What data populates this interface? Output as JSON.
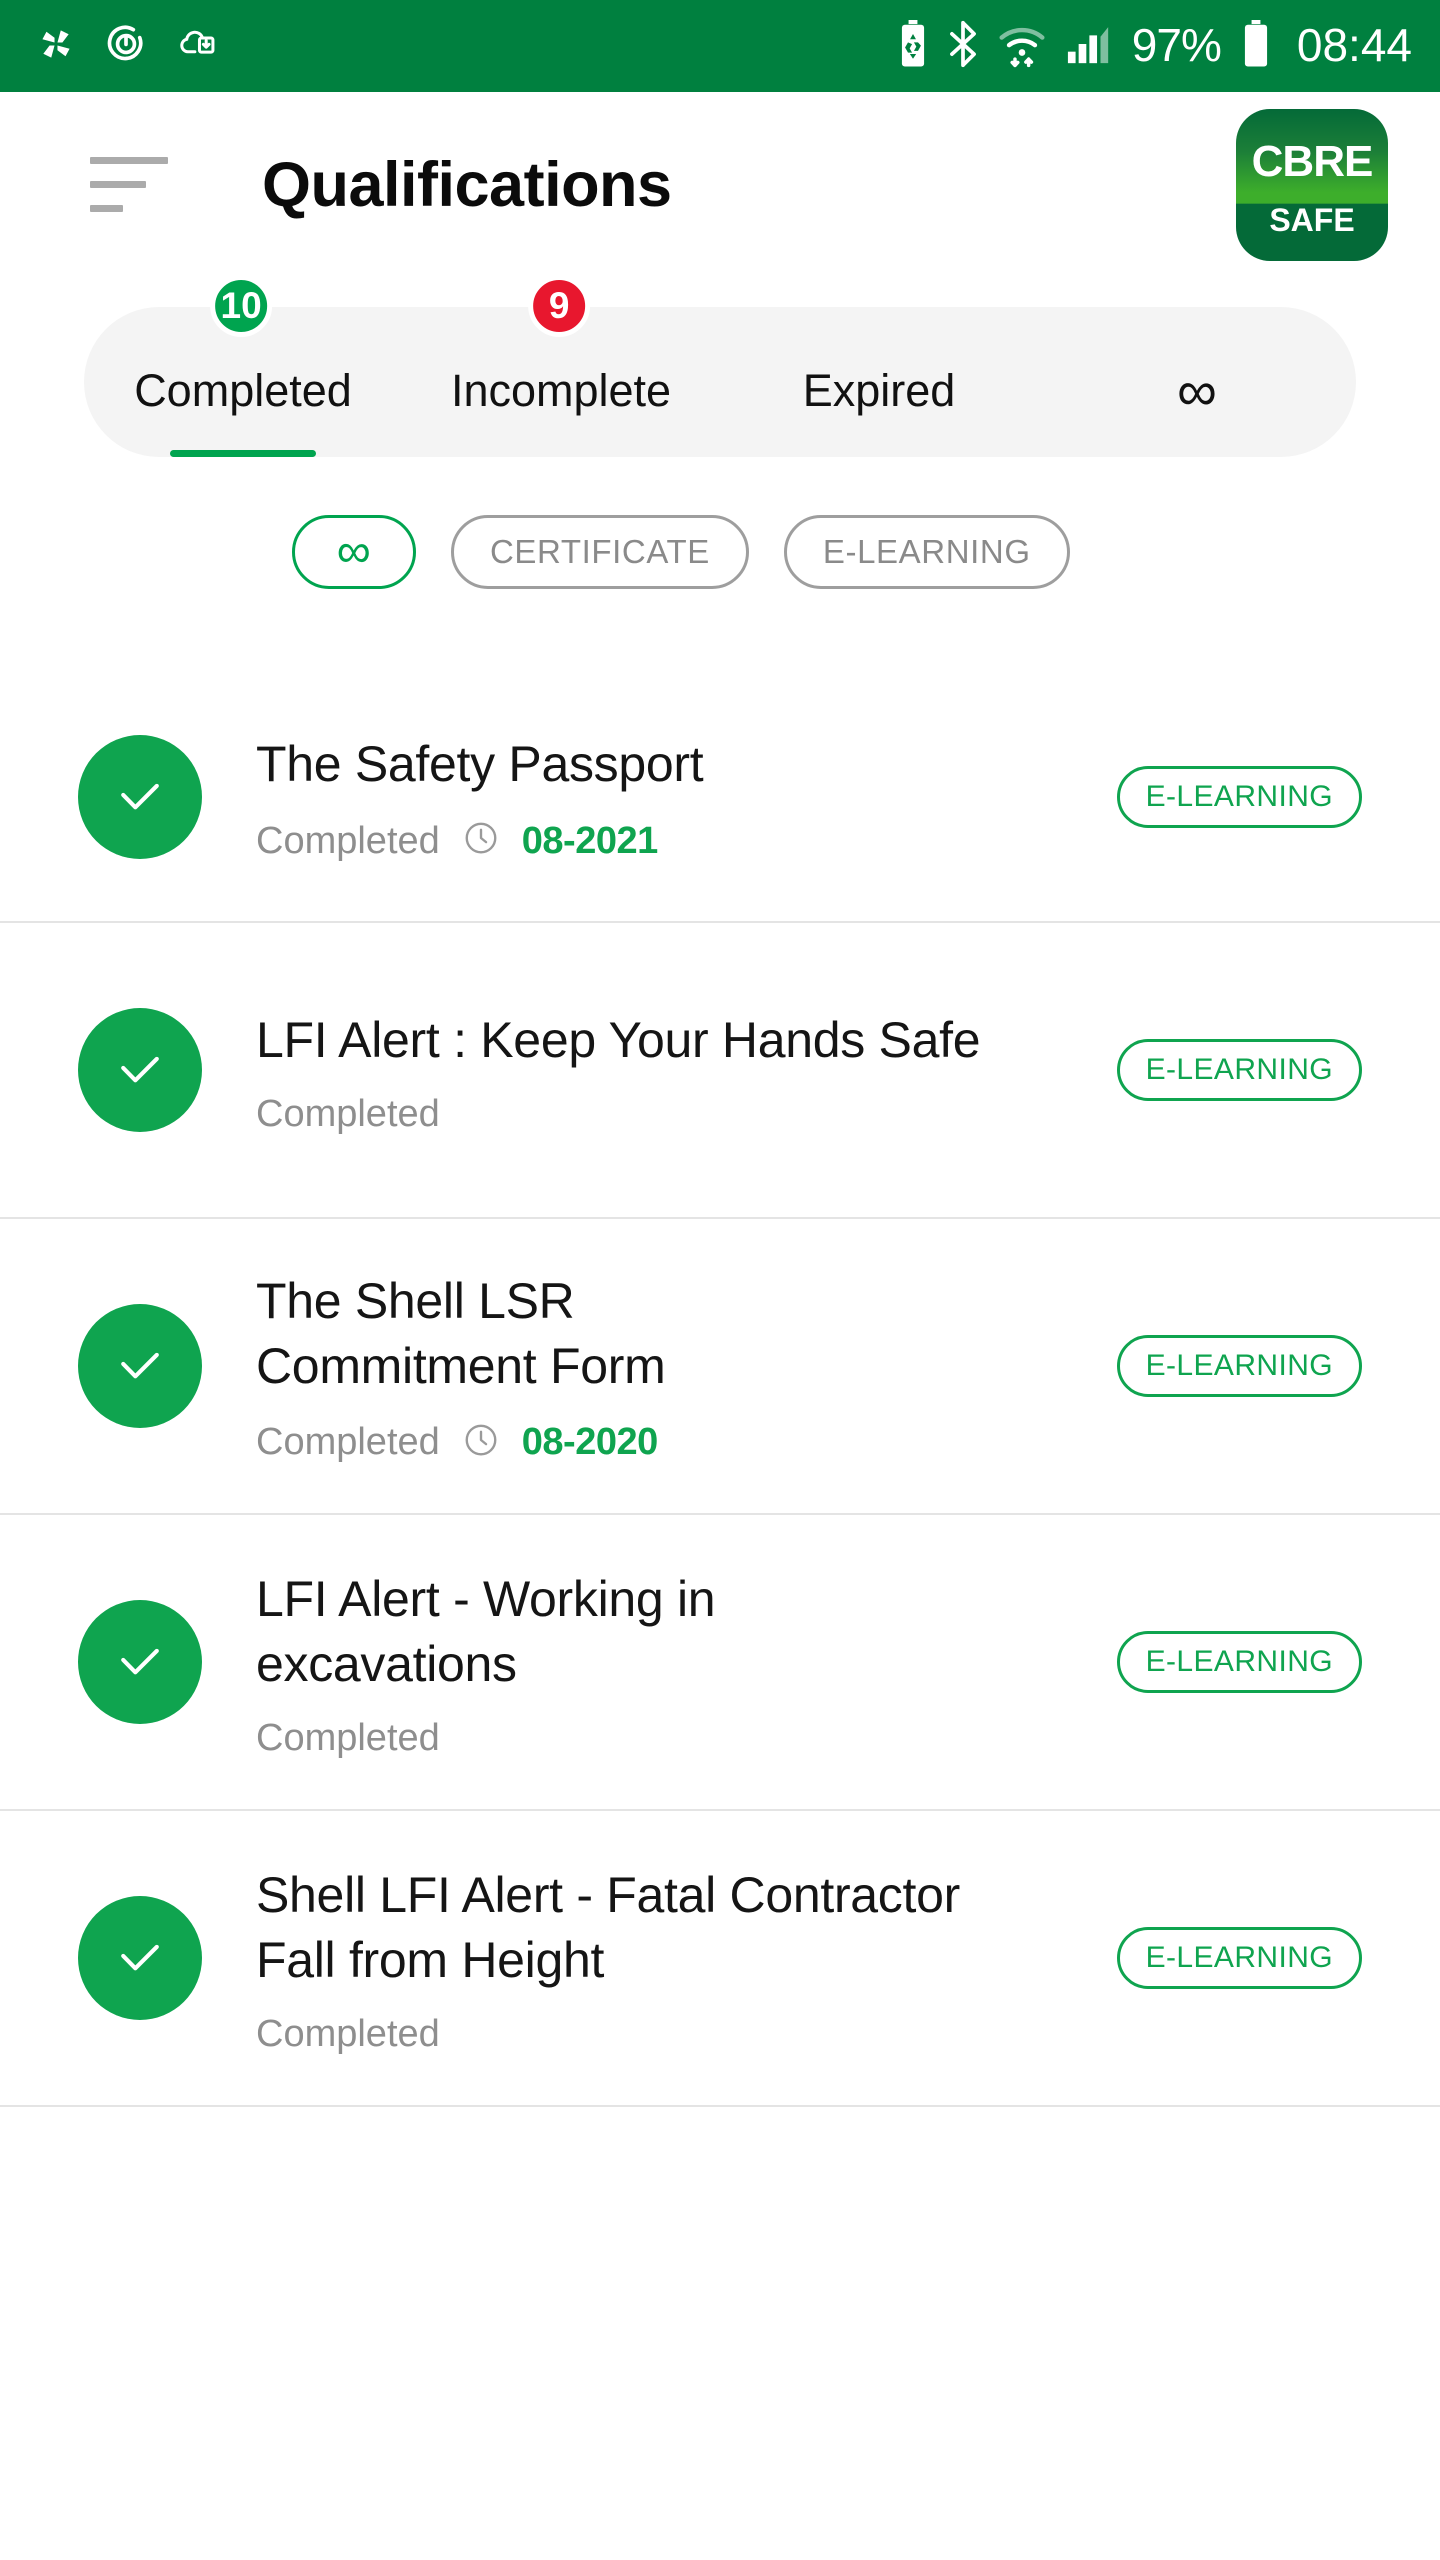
{
  "status_bar": {
    "background": "#00803F",
    "left_icons": [
      "pinwheel-icon",
      "power-sync-icon",
      "cloud-download-icon"
    ],
    "right_icons": [
      "battery-saver-icon",
      "bluetooth-icon",
      "wifi-icon",
      "signal-icon",
      "battery-icon"
    ],
    "battery_percent": "97%",
    "time": "08:44"
  },
  "header": {
    "menu_icon": "menu-icon",
    "title": "Qualifications",
    "logo": {
      "top_text": "CBRE",
      "bottom_text": "SAFE"
    }
  },
  "tabs": {
    "active_index": 0,
    "items": [
      {
        "label": "Completed",
        "badge": "10",
        "badge_color": "#00A44F",
        "active": true
      },
      {
        "label": "Incomplete",
        "badge": "9",
        "badge_color": "#E8172E",
        "active": false
      },
      {
        "label": "Expired",
        "badge": "",
        "badge_color": "",
        "active": false
      },
      {
        "label": "∞",
        "badge": "",
        "badge_color": "",
        "active": false
      }
    ]
  },
  "filters": {
    "active_index": 0,
    "chips": [
      {
        "label": "∞",
        "active": true,
        "icon": true
      },
      {
        "label": "CERTIFICATE",
        "active": false,
        "icon": false
      },
      {
        "label": "E-LEARNING",
        "active": false,
        "icon": false
      }
    ]
  },
  "list": {
    "accent_color": "#0FA44F",
    "items": [
      {
        "title": "The Safety Passport",
        "status": "Completed",
        "date": "08-2021",
        "has_date": true,
        "type": "E-LEARNING",
        "state_icon": "check-circle-icon"
      },
      {
        "title": "LFI Alert : Keep Your Hands Safe",
        "status": "Completed",
        "date": "",
        "has_date": false,
        "type": "E-LEARNING",
        "state_icon": "check-circle-icon"
      },
      {
        "title": "The Shell LSR Commitment Form",
        "status": "Completed",
        "date": "08-2020",
        "has_date": true,
        "type": "E-LEARNING",
        "state_icon": "check-circle-icon"
      },
      {
        "title": "LFI Alert - Working in excavations",
        "status": "Completed",
        "date": "",
        "has_date": false,
        "type": "E-LEARNING",
        "state_icon": "check-circle-icon"
      },
      {
        "title": "Shell LFI Alert - Fatal Contractor Fall from Height",
        "status": "Completed",
        "date": "",
        "has_date": false,
        "type": "E-LEARNING",
        "state_icon": "check-circle-icon"
      }
    ]
  }
}
